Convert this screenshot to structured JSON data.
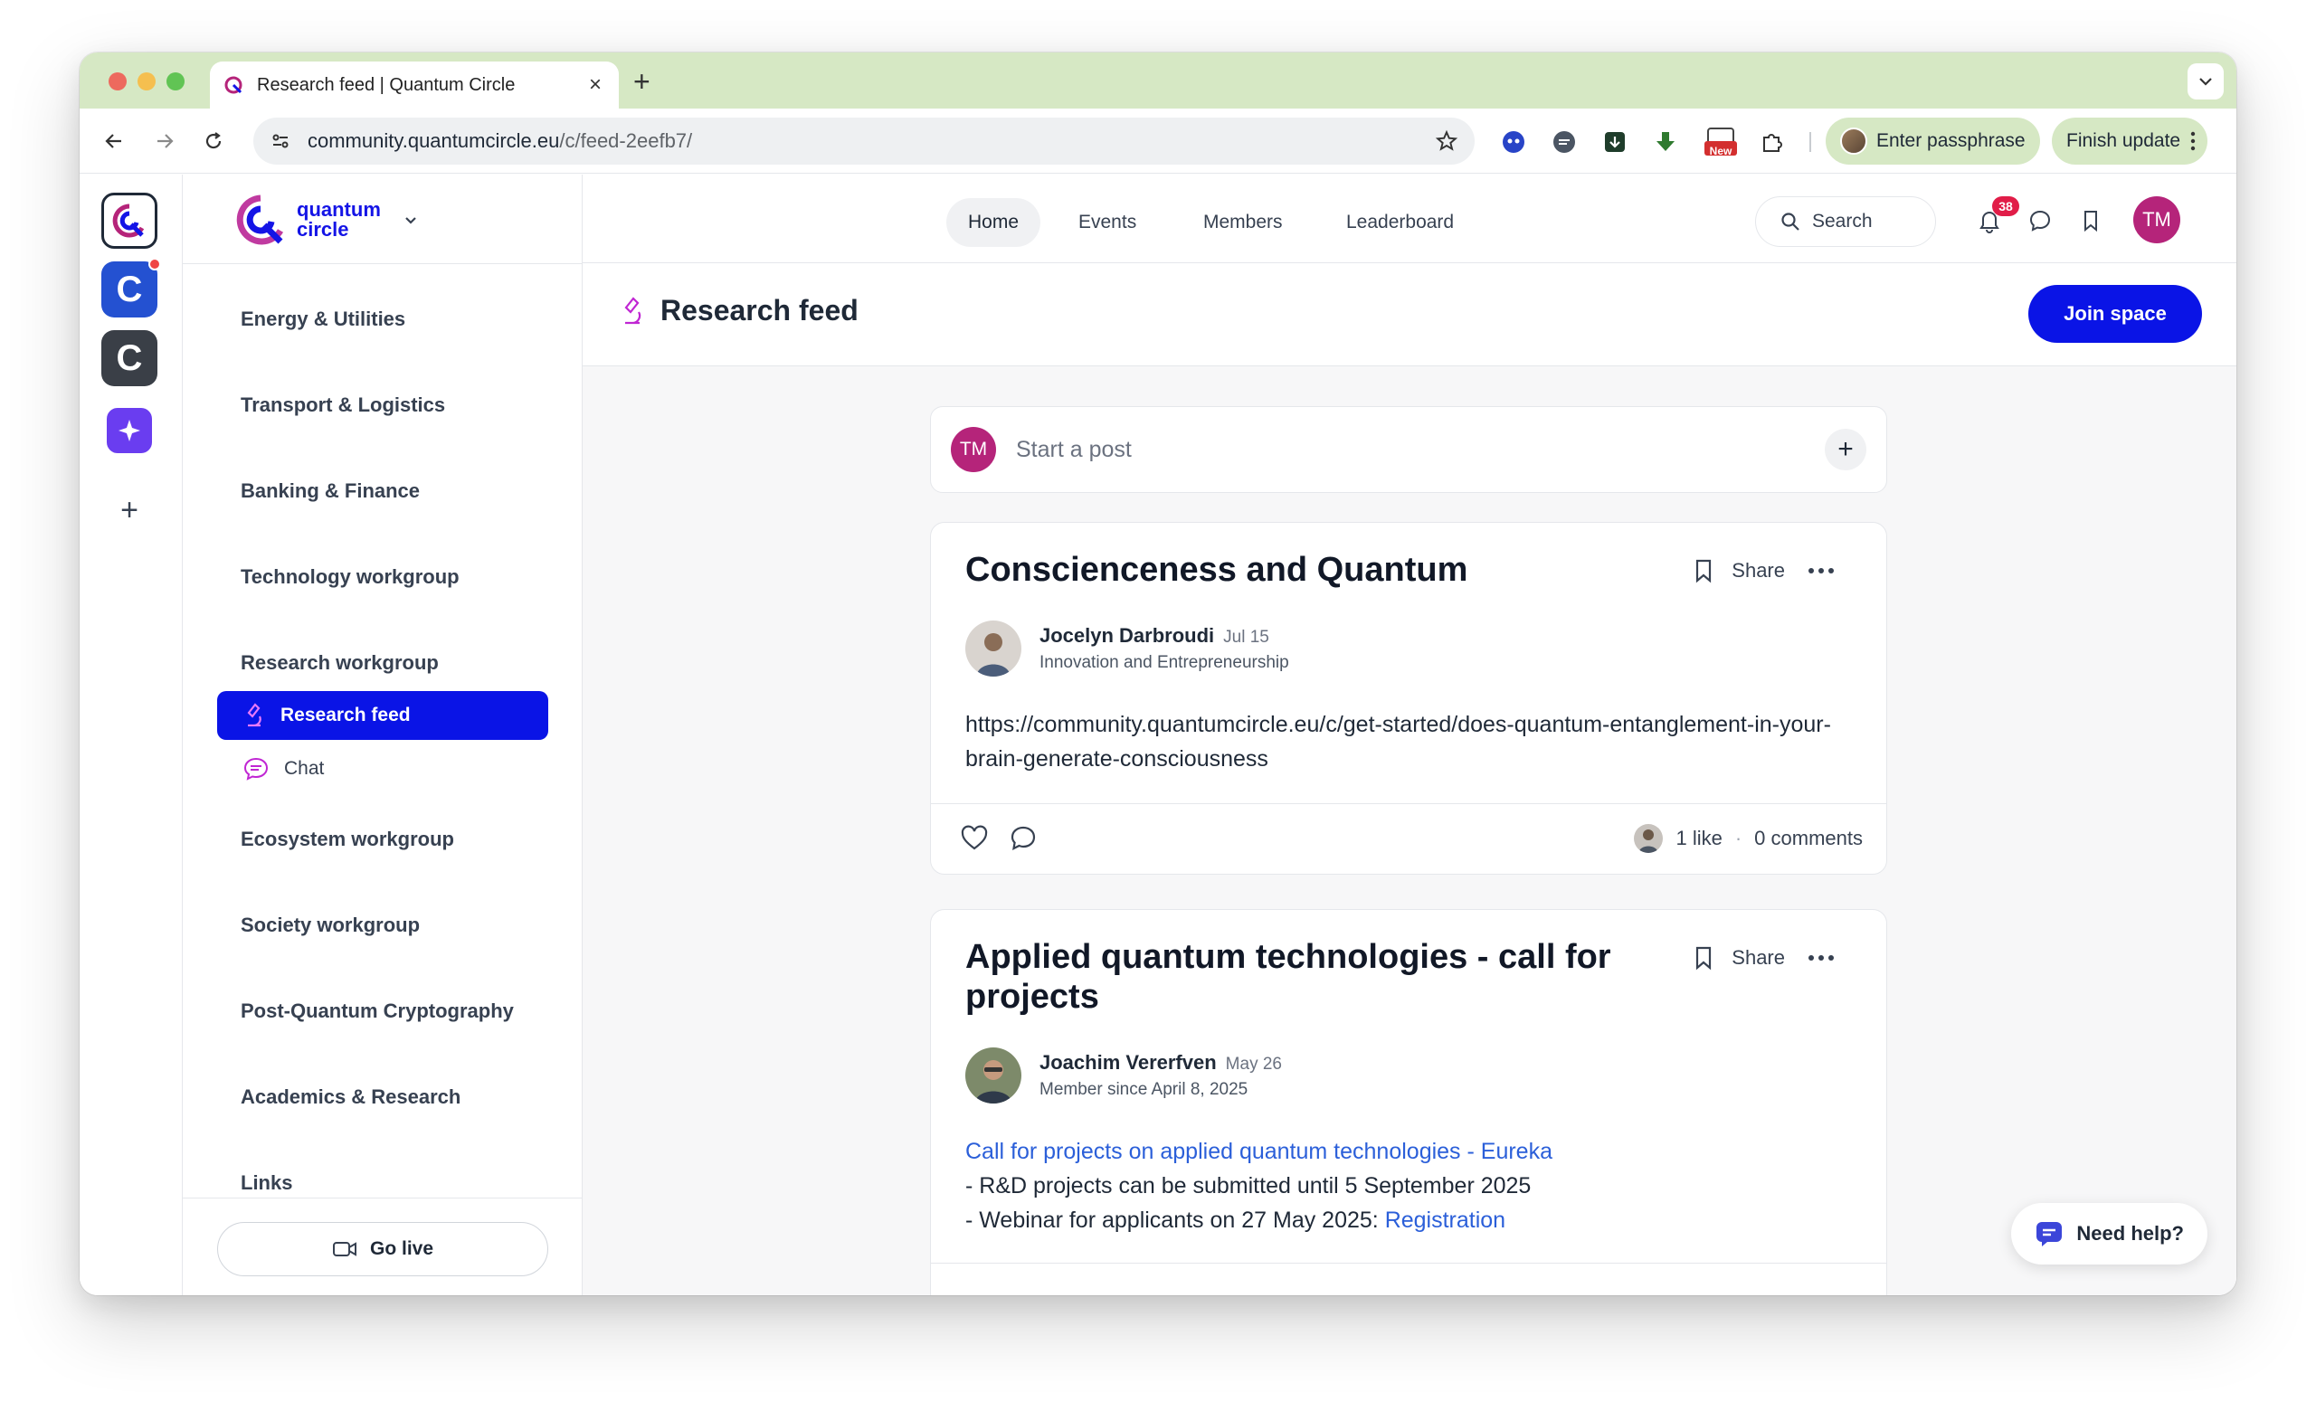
{
  "browser": {
    "tab_title": "Research feed | Quantum Circle",
    "url_host": "community.quantumcircle.eu",
    "url_path": "/c/feed-2eefb7/",
    "passphrase_label": "Enter passphrase",
    "update_label": "Finish update",
    "new_badge": "New"
  },
  "brand": {
    "line1": "quantum",
    "line2": "circle"
  },
  "nav": {
    "home": "Home",
    "events": "Events",
    "members": "Members",
    "leaderboard": "Leaderboard",
    "search_placeholder": "Search",
    "notification_count": "38",
    "user_initials": "TM"
  },
  "sidebar": {
    "groups": [
      "Energy & Utilities",
      "Transport & Logistics",
      "Banking & Finance",
      "Technology workgroup",
      "Research workgroup",
      "Ecosystem workgroup",
      "Society workgroup",
      "Post-Quantum Cryptography",
      "Academics & Research",
      "Links"
    ],
    "active_item": "Research feed",
    "chat_item": "Chat",
    "go_live": "Go live"
  },
  "space": {
    "title": "Research feed",
    "join_label": "Join space"
  },
  "composer": {
    "placeholder": "Start a post",
    "initials": "TM"
  },
  "posts": [
    {
      "title": "Conscienceness and Quantum",
      "author": "Jocelyn Darbroudi",
      "date": "Jul 15",
      "subtitle": "Innovation and Entrepreneurship",
      "body": "https://community.quantumcircle.eu/c/get-started/does-quantum-entanglement-in-your-brain-generate-consciousness",
      "likes": "1 like",
      "comments": "0 comments",
      "share": "Share"
    },
    {
      "title": "Applied quantum technologies - call for projects",
      "author": "Joachim Vererfven",
      "date": "May 26",
      "subtitle": "Member since April 8, 2025",
      "link_text": "Call for projects on applied quantum technologies - Eureka",
      "line2": "- R&D projects can be submitted until 5 September 2025",
      "line3_prefix": "- Webinar for applicants on 27 May 2025: ",
      "line3_link": "Registration",
      "share": "Share"
    }
  ],
  "help": {
    "label": "Need help?"
  },
  "colors": {
    "brand_blue": "#0a14e6",
    "avatar_magenta": "#b5247a",
    "tabstrip_green": "#d6e8c4",
    "link_blue": "#2b5fd9"
  }
}
